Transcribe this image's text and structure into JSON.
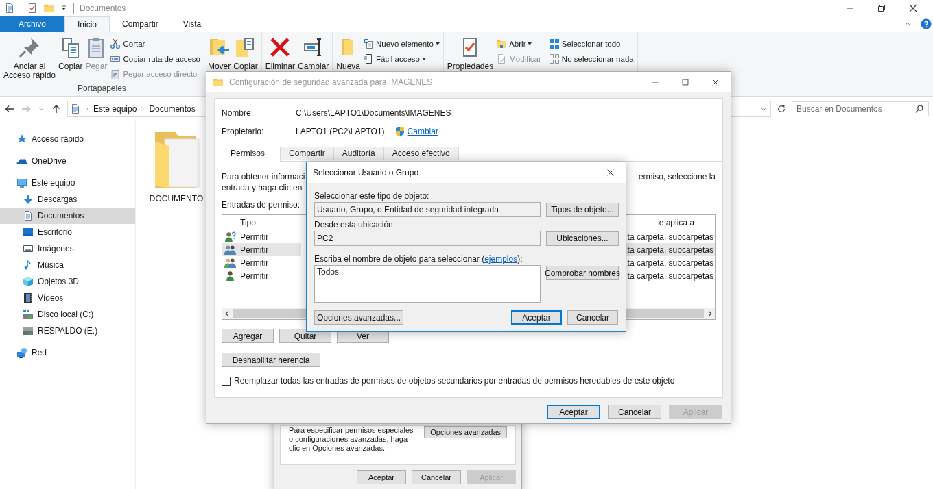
{
  "explorer": {
    "title": "Documentos",
    "ribbon_tabs": [
      {
        "label": "Archivo",
        "kind": "file",
        "selected": false
      },
      {
        "label": "Inicio",
        "kind": "tab",
        "selected": true
      },
      {
        "label": "Compartir",
        "kind": "tab",
        "selected": false
      },
      {
        "label": "Vista",
        "kind": "tab",
        "selected": false
      }
    ],
    "ribbon_groups": [
      {
        "label": "Portapapeles",
        "large": [
          {
            "label": "Anclar al\nAcceso rápido",
            "disabled": false
          },
          {
            "label": "Copiar",
            "disabled": false
          },
          {
            "label": "Pegar",
            "disabled": true
          }
        ],
        "small": [
          {
            "label": "Cortar",
            "disabled": false,
            "dropdown": false
          },
          {
            "label": "Copiar ruta de acceso",
            "disabled": false,
            "dropdown": false
          },
          {
            "label": "Pegar acceso directo",
            "disabled": true,
            "dropdown": false
          }
        ]
      },
      {
        "large": [
          {
            "label": "Mover",
            "disabled": false
          },
          {
            "label": "Copiar",
            "disabled": false
          }
        ]
      },
      {
        "large": [
          {
            "label": "Eliminar",
            "disabled": false
          },
          {
            "label": "Cambiar",
            "disabled": false
          }
        ]
      },
      {
        "large": [
          {
            "label": "Nueva",
            "disabled": false
          }
        ],
        "small": [
          {
            "label": "Nuevo elemento",
            "disabled": false,
            "dropdown": true
          },
          {
            "label": "Fácil acceso",
            "disabled": false,
            "dropdown": true
          }
        ]
      },
      {
        "large": [
          {
            "label": "Propiedades",
            "disabled": false
          }
        ],
        "small": [
          {
            "label": "Abrir",
            "disabled": false,
            "dropdown": true
          },
          {
            "label": "Modificar",
            "disabled": true,
            "dropdown": false
          }
        ]
      },
      {
        "small": [
          {
            "label": "Seleccionar todo",
            "disabled": false,
            "dropdown": false
          },
          {
            "label": "No seleccionar nada",
            "disabled": false,
            "dropdown": false
          }
        ]
      }
    ],
    "address": {
      "path": [
        "Este equipo",
        "Documentos"
      ],
      "search_placeholder": "Buscar en Documentos"
    },
    "sidebar": [
      {
        "label": "Acceso rápido",
        "selected": false
      },
      {
        "label": "OneDrive",
        "selected": false
      },
      {
        "label": "Este equipo",
        "selected": false,
        "children": [
          {
            "label": "Descargas",
            "selected": false
          },
          {
            "label": "Documentos",
            "selected": true
          },
          {
            "label": "Escritorio",
            "selected": false
          },
          {
            "label": "Imágenes",
            "selected": false
          },
          {
            "label": "Música",
            "selected": false
          },
          {
            "label": "Objetos 3D",
            "selected": false
          },
          {
            "label": "Vídeos",
            "selected": false
          },
          {
            "label": "Disco local (C:)",
            "selected": false
          },
          {
            "label": "RESPALDO (E:)",
            "selected": false
          }
        ]
      },
      {
        "label": "Red",
        "selected": false
      }
    ],
    "files": [
      {
        "name": "DOCUMENTO"
      }
    ]
  },
  "properties_dialog": {
    "text": "Para especificar permisos especiales o configuraciones avanzadas, haga clic en Opciones avanzadas.",
    "advanced_button": "Opciones avanzadas",
    "buttons": [
      {
        "label": "Aceptar",
        "default": false,
        "disabled": false
      },
      {
        "label": "Cancelar",
        "default": false,
        "disabled": false
      },
      {
        "label": "Aplicar",
        "default": false,
        "disabled": true
      }
    ]
  },
  "advanced_dialog": {
    "title": "Configuración de seguridad avanzada para IMAGENES",
    "name_label": "Nombre:",
    "name_value": "C:\\Users\\LAPTO1\\Documents\\IMAGENES",
    "owner_label": "Propietario:",
    "owner_value": "LAPTO1 (PC2\\LAPTO1)",
    "change_link": "Cambiar",
    "tabs": [
      {
        "label": "Permisos",
        "selected": true
      },
      {
        "label": "Compartir",
        "selected": false
      },
      {
        "label": "Auditoría",
        "selected": false
      },
      {
        "label": "Acceso efectivo",
        "selected": false
      }
    ],
    "info_left": [
      "Para obtener informaci",
      "entrada y haga clic en"
    ],
    "info_right": [
      "ermiso, seleccione la"
    ],
    "entries_label": "Entradas de permiso:",
    "columns": [
      "Tipo",
      "e aplica a"
    ],
    "rows": [
      {
        "type": "Permitir",
        "applies": "ta carpeta, subcarpetas",
        "selected": false
      },
      {
        "type": "Permitir",
        "applies": "ta carpeta, subcarpetas",
        "selected": true
      },
      {
        "type": "Permitir",
        "applies": "ta carpeta, subcarpetas",
        "selected": false
      },
      {
        "type": "Permitir",
        "applies": "ta carpeta, subcarpetas",
        "selected": false
      }
    ],
    "entry_buttons": [
      "Agregar",
      "Quitar",
      "Ver"
    ],
    "inheritance_button": "Deshabilitar herencia",
    "replace_checkbox": {
      "label": "Reemplazar todas las entradas de permisos de objetos secundarios por entradas de permisos heredables de este objeto",
      "checked": false
    },
    "buttons": [
      {
        "label": "Aceptar",
        "default": true,
        "disabled": false
      },
      {
        "label": "Cancelar",
        "default": false,
        "disabled": false
      },
      {
        "label": "Aplicar",
        "default": false,
        "disabled": true
      }
    ]
  },
  "select_dialog": {
    "title": "Seleccionar Usuario o Grupo",
    "object_type_label": "Seleccionar este tipo de objeto:",
    "object_type_value": "Usuario, Grupo, o Entidad de seguridad integrada",
    "object_types_button": "Tipos de objeto...",
    "location_label": "Desde esta ubicación:",
    "location_value": "PC2",
    "locations_button": "Ubicaciones...",
    "names_label": "Escriba el nombre de objeto para seleccionar (",
    "examples_link": "ejemplos",
    "names_label_end": "):",
    "names_value": "Todos",
    "check_button": "Comprobar nombres",
    "advanced_button": "Opciones avanzadas...",
    "buttons": [
      {
        "label": "Aceptar",
        "default": true
      },
      {
        "label": "Cancelar",
        "default": false
      }
    ]
  }
}
